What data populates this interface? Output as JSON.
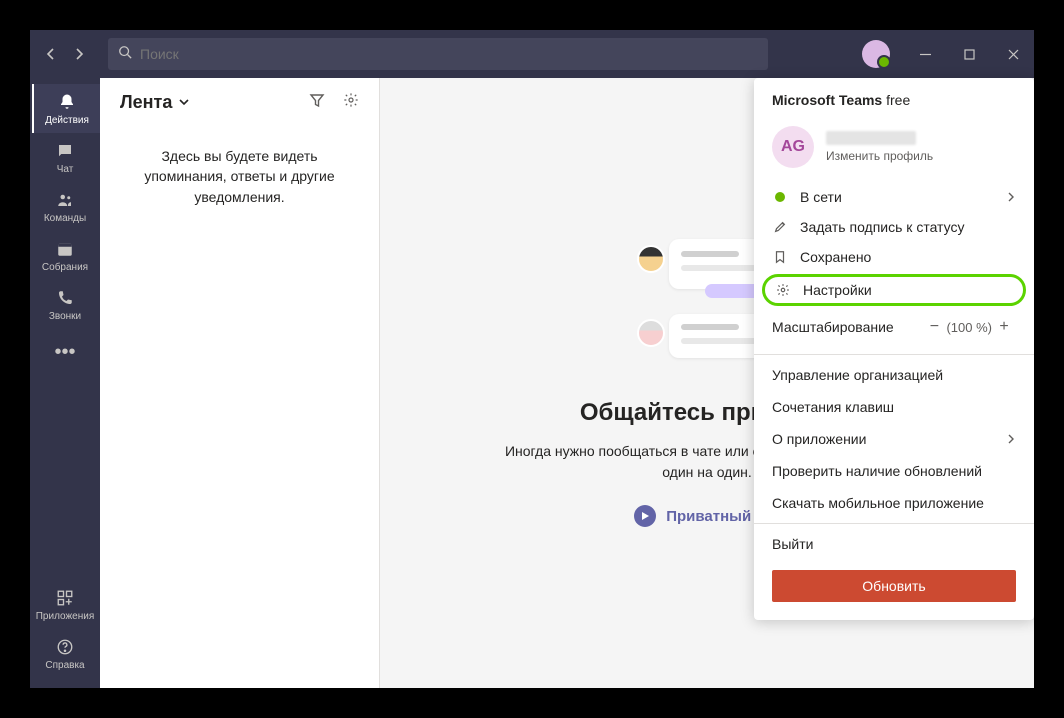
{
  "search": {
    "placeholder": "Поиск"
  },
  "sidebar": {
    "items": [
      {
        "label": "Действия"
      },
      {
        "label": "Чат"
      },
      {
        "label": "Команды"
      },
      {
        "label": "Собрания"
      },
      {
        "label": "Звонки"
      }
    ],
    "apps_label": "Приложения",
    "help_label": "Справка"
  },
  "feed": {
    "title": "Лента",
    "empty": "Здесь вы будете видеть упоминания, ответы и другие уведомления."
  },
  "center": {
    "heading": "Общайтесь приватно",
    "body": "Иногда нужно пообщаться в чате или совершить видеозвонок один на один.",
    "link": "Приватный чат"
  },
  "profile_panel": {
    "title_bold": "Microsoft Teams",
    "title_rest": "free",
    "avatar_initials": "AG",
    "edit_profile": "Изменить профиль",
    "status": {
      "label": "В сети"
    },
    "set_status": "Задать подпись к статусу",
    "saved": "Сохранено",
    "settings": "Настройки",
    "zoom_label": "Масштабирование",
    "zoom_value": "(100 %)",
    "manage_org": "Управление организацией",
    "shortcuts": "Сочетания клавиш",
    "about": "О приложении",
    "check_updates": "Проверить наличие обновлений",
    "download_mobile": "Скачать мобильное приложение",
    "sign_out": "Выйти",
    "update_btn": "Обновить"
  }
}
